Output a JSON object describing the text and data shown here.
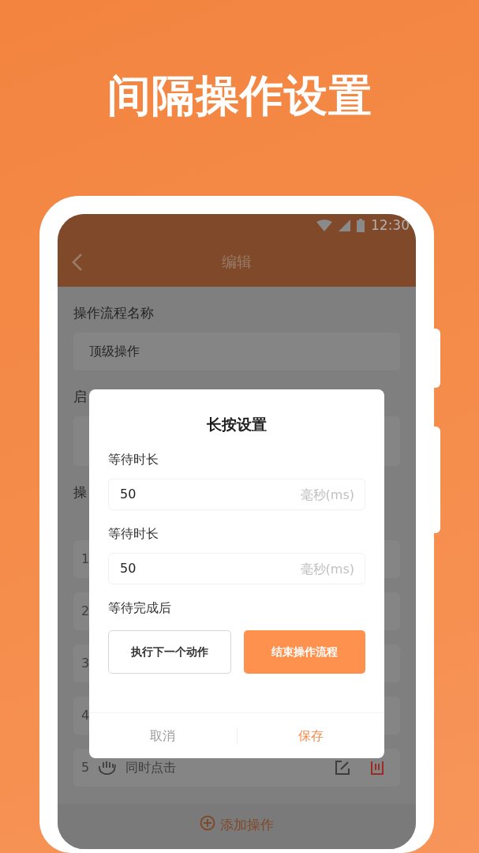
{
  "headline": "间隔操作设置",
  "status_bar": {
    "time": "12:30"
  },
  "app_bar": {
    "title": "编辑"
  },
  "form": {
    "name_label": "操作流程名称",
    "name_value": "顶级操作",
    "start_label": "启",
    "operations_label": "操"
  },
  "operations": [
    {
      "number": "1"
    },
    {
      "number": "2"
    },
    {
      "number": "3"
    },
    {
      "number": "4"
    },
    {
      "number": "5",
      "name": "同时点击"
    }
  ],
  "add_button": "添加操作",
  "dialog": {
    "title": "长按设置",
    "fields": [
      {
        "label": "等待时长",
        "value": "50",
        "unit": "毫秒(ms)"
      },
      {
        "label": "等待时长",
        "value": "50",
        "unit": "毫秒(ms)"
      }
    ],
    "after_label": "等待完成后",
    "choices": [
      {
        "label": "执行下一个动作",
        "selected": false
      },
      {
        "label": "结束操作流程",
        "selected": true
      }
    ],
    "cancel": "取消",
    "save": "保存"
  }
}
